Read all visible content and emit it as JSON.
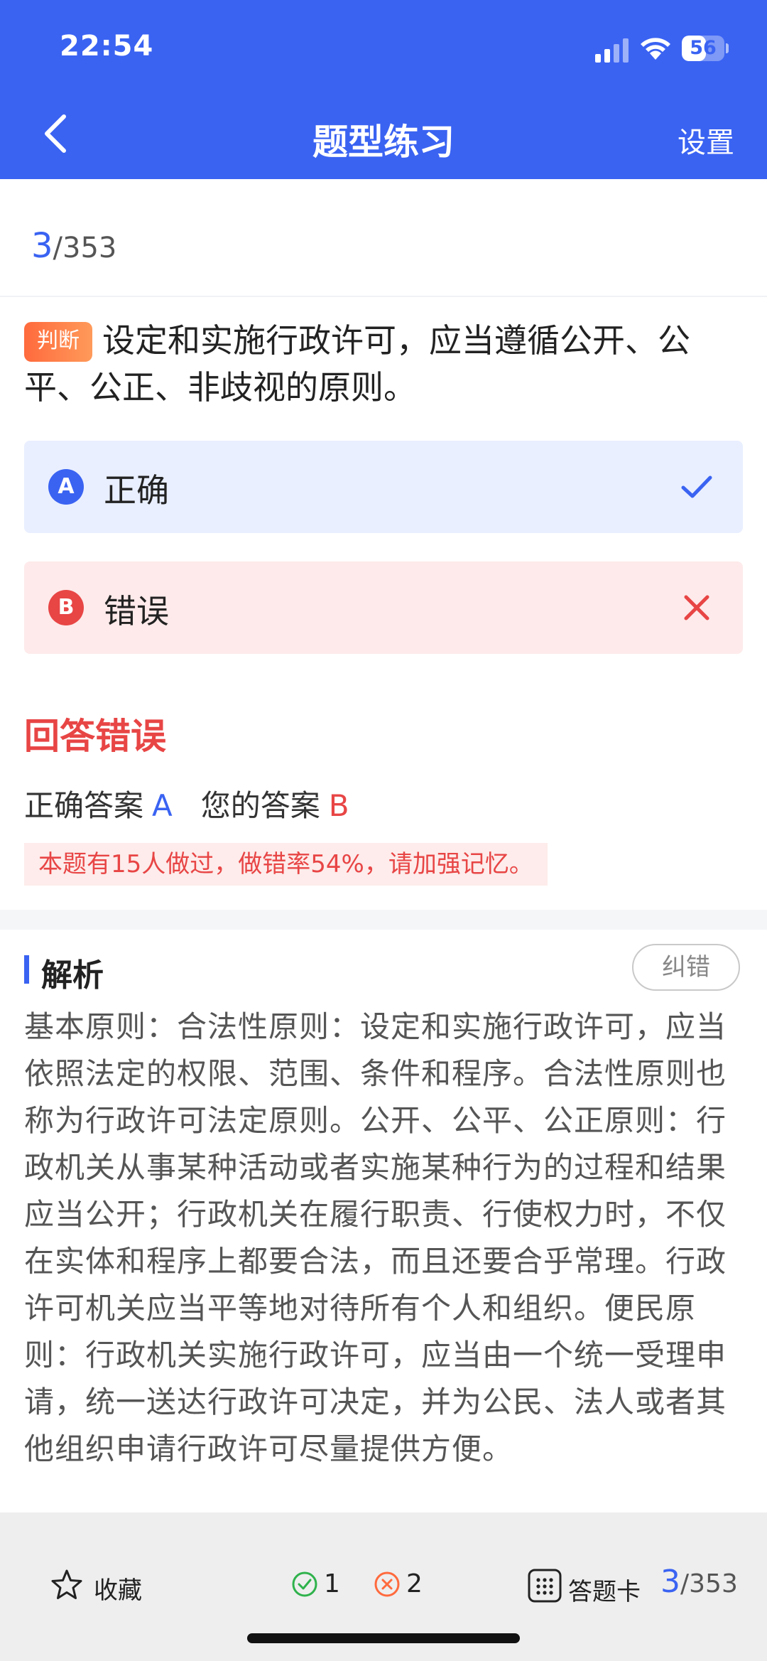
{
  "status_bar": {
    "time": "22:54",
    "battery": "56",
    "battery_level_percent": 56
  },
  "header": {
    "title": "题型练习",
    "settings_label": "设置",
    "back_icon": "chevron-left-icon"
  },
  "progress": {
    "current": "3",
    "total": "/353"
  },
  "question": {
    "type_badge": "判断",
    "text": "设定和实施行政许可，应当遵循公开、公平、公正、非歧视的原则。"
  },
  "options": [
    {
      "letter": "A",
      "text": "正确",
      "state": "correct",
      "mark_icon": "check-icon",
      "color": "#3a63f2"
    },
    {
      "letter": "B",
      "text": "错误",
      "state": "wrong",
      "mark_icon": "cross-icon",
      "color": "#e84545"
    }
  ],
  "result": {
    "title": "回答错误",
    "correct_label": "正确答案",
    "correct_value": "A",
    "your_label": "您的答案",
    "your_value": "B",
    "note": "本题有15人做过，做错率54%，请加强记忆。"
  },
  "analysis": {
    "title": "解析",
    "report_button": "纠错",
    "body": "基本原则：合法性原则：设定和实施行政许可，应当依照法定的权限、范围、条件和程序。合法性原则也称为行政许可法定原则。公开、公平、公正原则：行政机关从事某种活动或者实施某种行为的过程和结果应当公开；行政机关在履行职责、行使权力时，不仅在实体和程序上都要合法，而且还要合乎常理。行政许可机关应当平等地对待所有个人和组织。便民原则：行政机关实施行政许可，应当由一个统一受理申请，统一送达行政许可决定，并为公民、法人或者其他组织申请行政许可尽量提供方便。"
  },
  "bottom_bar": {
    "favorite_label": "收藏",
    "right_count": "1",
    "wrong_count": "2",
    "answer_card_label": "答题卡",
    "progress_current": "3",
    "progress_total": "/353"
  },
  "colors": {
    "primary": "#3a63f2",
    "error": "#e84545",
    "correct_green": "#2fb24c",
    "wrong_orange": "#ff6a3d"
  }
}
